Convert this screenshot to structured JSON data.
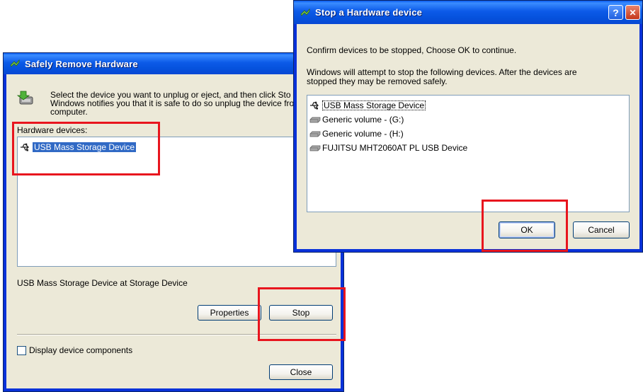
{
  "safely_remove": {
    "title": "Safely Remove Hardware",
    "instruction_line1": "Select the device you want to unplug or eject, and then click Sto",
    "instruction_line2": "Windows notifies you that it is safe to do so unplug the device fro",
    "instruction_line3": "computer.",
    "devices_label": "Hardware devices:",
    "devices": [
      {
        "label": "USB Mass Storage Device",
        "icon": "usb-icon",
        "selected": true
      }
    ],
    "status_text": "USB Mass Storage Device at Storage Device",
    "properties_label": "Properties",
    "stop_label": "Stop",
    "display_components_label": "Display device components",
    "display_components_checked": false,
    "close_label": "Close"
  },
  "stop_device": {
    "title": "Stop a Hardware device",
    "confirm_text": "Confirm devices to be stopped, Choose OK to continue.",
    "info_line1": "Windows will attempt to stop the following devices. After the devices are",
    "info_line2": "stopped they may be removed safely.",
    "devices": [
      {
        "label": "USB Mass Storage Device",
        "icon": "usb-icon",
        "focused": true
      },
      {
        "label": "Generic volume - (G:)",
        "icon": "drive-icon"
      },
      {
        "label": "Generic volume - (H:)",
        "icon": "drive-icon"
      },
      {
        "label": "FUJITSU MHT2060AT PL USB Device",
        "icon": "drive-icon"
      }
    ],
    "ok_label": "OK",
    "cancel_label": "Cancel",
    "help_glyph": "?",
    "close_glyph": "✕"
  },
  "colors": {
    "highlight": "#e8151e",
    "selection": "#316ac5",
    "titlebar": "#0551dc",
    "dialog_bg": "#ece9d8"
  }
}
